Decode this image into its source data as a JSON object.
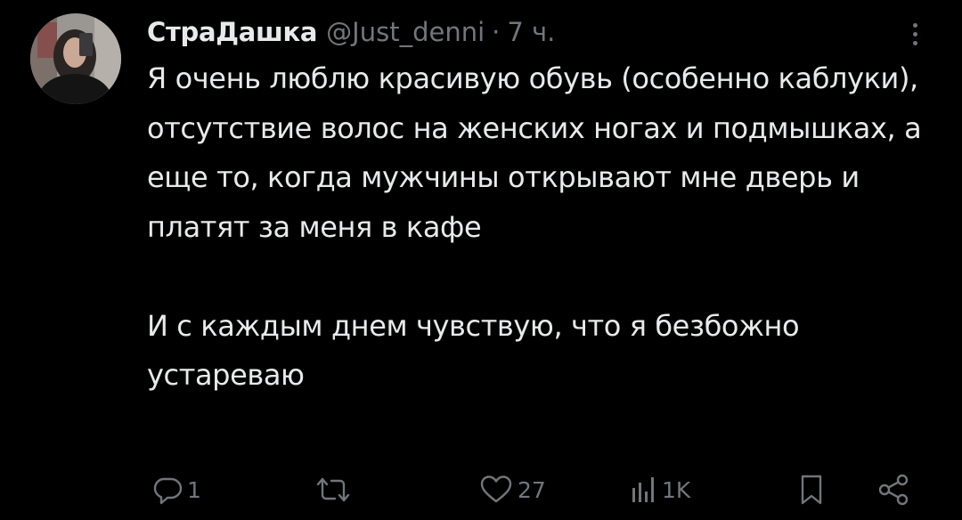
{
  "tweet": {
    "author": {
      "display_name": "СтраДашка",
      "handle": "@Just_denni",
      "separator": "·",
      "time": "7 ч."
    },
    "paragraphs": [
      "Я очень люблю красивую обувь (особенно каблуки), отсутствие волос на женских ногах и подмышках, а еще то, когда мужчины открывают мне дверь и платят за меня в кафе",
      "И с каждым днем чувствую, что я безбожно устареваю"
    ],
    "actions": {
      "reply_count": "1",
      "retweet_count": "",
      "like_count": "27",
      "views_count": "1K"
    },
    "icons": {
      "reply": "reply-icon",
      "retweet": "retweet-icon",
      "like": "heart-icon",
      "views": "views-icon",
      "bookmark": "bookmark-icon",
      "share": "share-icon",
      "more": "more-icon"
    }
  },
  "colors": {
    "background": "#000000",
    "text_primary": "#e7e9ea",
    "text_secondary": "#71767b"
  }
}
